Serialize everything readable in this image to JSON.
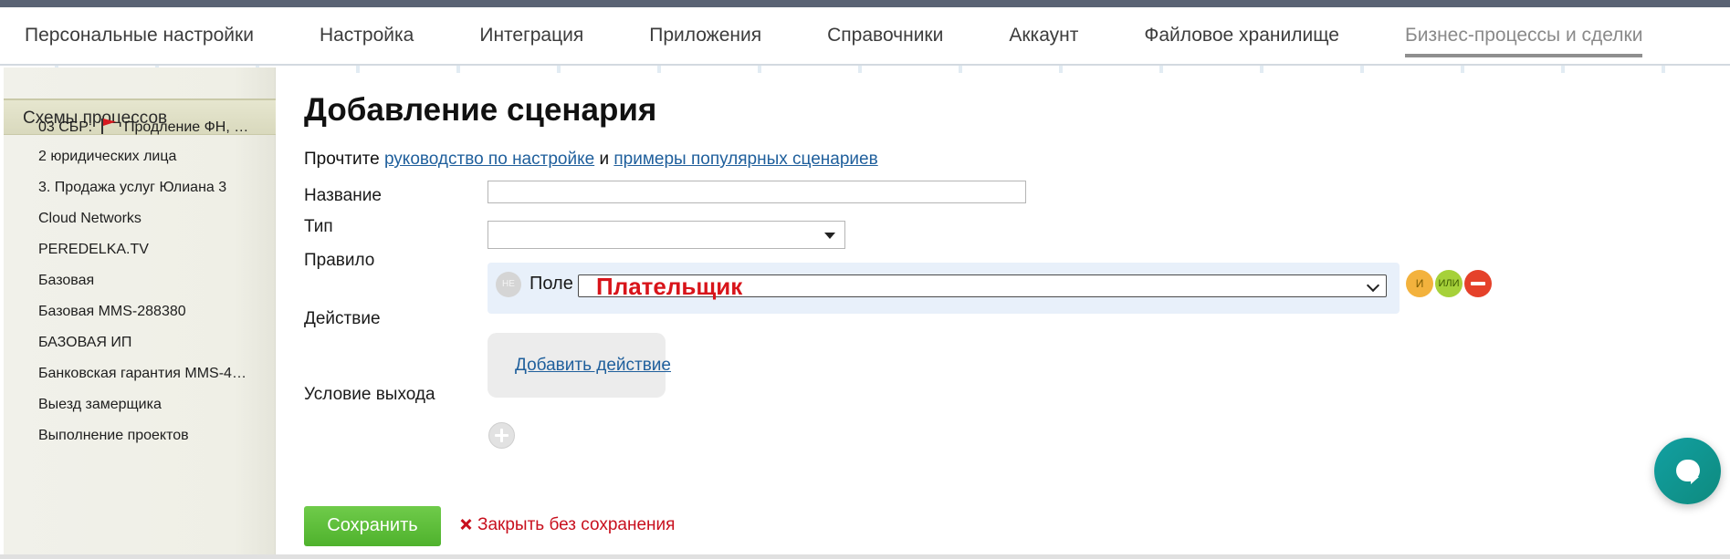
{
  "topnav": {
    "items": [
      {
        "label": "Персональные настройки"
      },
      {
        "label": "Настройка"
      },
      {
        "label": "Интеграция"
      },
      {
        "label": "Приложения"
      },
      {
        "label": "Справочники"
      },
      {
        "label": "Аккаунт"
      },
      {
        "label": "Файловое хранилище"
      },
      {
        "label": "Бизнес-процессы и сделки",
        "active": true
      }
    ]
  },
  "sidebar": {
    "header": "Схемы процессов",
    "items": [
      {
        "label_before_flag": "03 СБР:",
        "label_after_flag": "Продление ФН, …",
        "flag_icon": "red-flag-icon"
      },
      {
        "label": "2 юридических лица"
      },
      {
        "label": "3. Продажа услуг Юлиана 3"
      },
      {
        "label": "Cloud Networks"
      },
      {
        "label": "PEREDELKA.TV"
      },
      {
        "label": "Базовая"
      },
      {
        "label": "Базовая MMS-288380"
      },
      {
        "label": "БАЗОВАЯ ИП"
      },
      {
        "label": "Банковская гарантия MMS-4…"
      },
      {
        "label": "Выезд замерщика"
      },
      {
        "label": "Выполнение проектов"
      }
    ]
  },
  "main": {
    "title": "Добавление сценария",
    "intro": {
      "prefix": "Прочтите",
      "link1": "руководство по настройке",
      "middle": "и",
      "link2": "примеры популярных сценариев"
    },
    "name_label": "Название",
    "name_value": "",
    "type_label": "Тип",
    "type_value": "",
    "rule_label": "Правило",
    "rule": {
      "not_button": "НЕ",
      "field_label": "Поле",
      "field_value": "Плательщик",
      "and_button": "И",
      "or_button": "ИЛИ",
      "remove_icon": "minus-circle-icon"
    },
    "action_label": "Действие",
    "add_action": "Добавить действие",
    "exit_label": "Условие выхода",
    "add_exit_icon": "plus-circle-icon",
    "save_button": "Сохранить",
    "close_link": "Закрыть без сохранения"
  },
  "chat": {
    "icon": "chat-bubble-icon"
  },
  "colors": {
    "accent_green": "#5cbd38",
    "link_blue": "#1f5f9c",
    "danger_red": "#c8101e",
    "highlight_red": "#d8141a",
    "rule_bg": "#e8f0fa"
  }
}
